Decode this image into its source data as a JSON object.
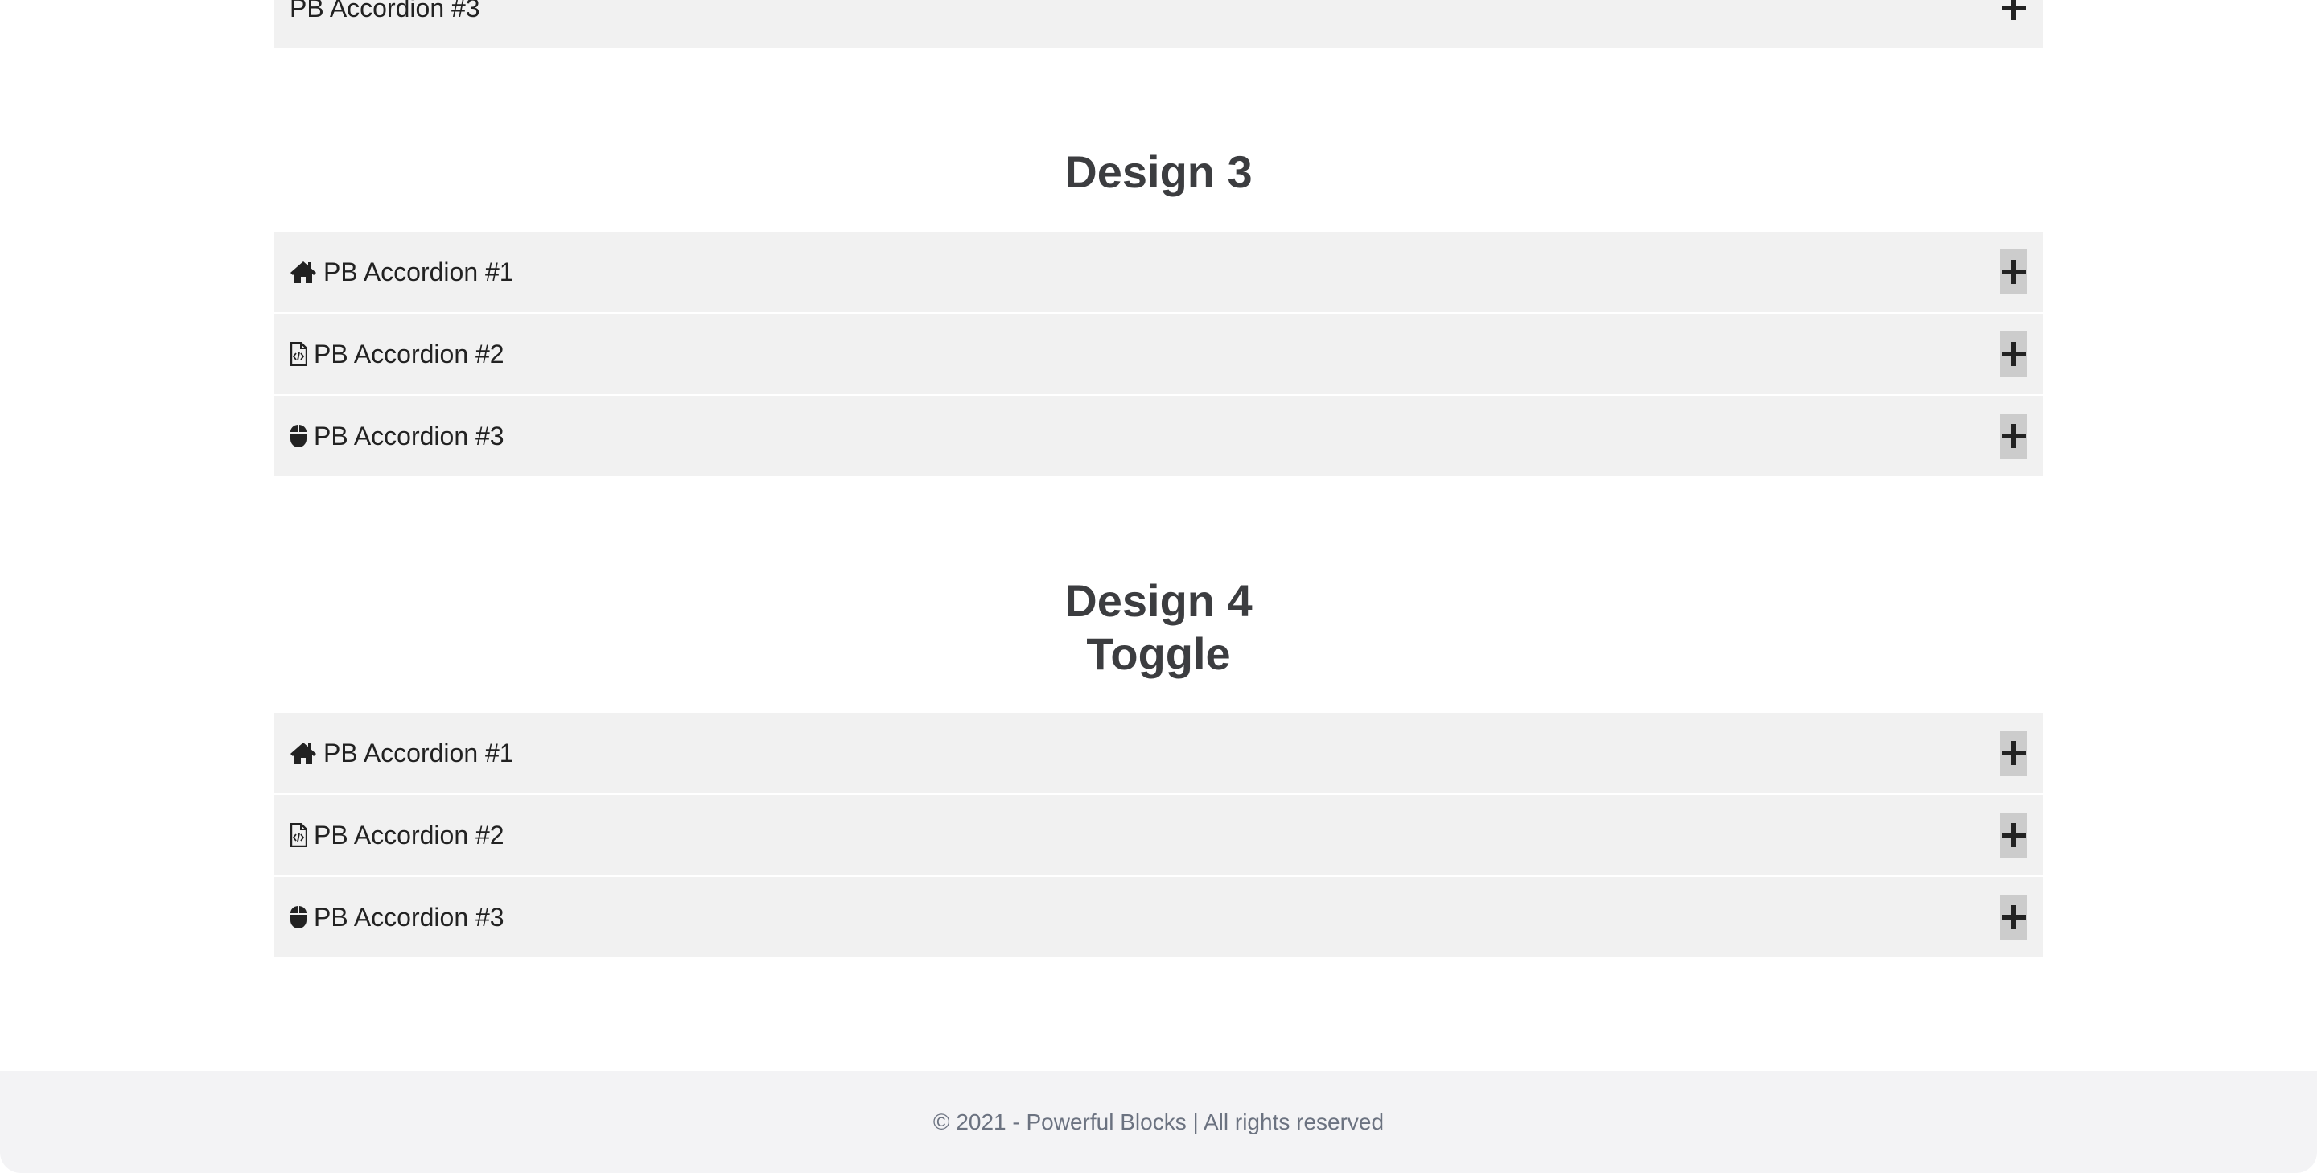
{
  "top_partial": {
    "label": "PB Accordion #3"
  },
  "design3": {
    "title": "Design 3",
    "items": [
      {
        "label": "PB Accordion #1",
        "icon": "home-icon"
      },
      {
        "label": "PB Accordion #2",
        "icon": "file-code-icon"
      },
      {
        "label": "PB Accordion #3",
        "icon": "mouse-icon"
      }
    ]
  },
  "design4": {
    "title_line1": "Design 4",
    "title_line2": "Toggle",
    "items": [
      {
        "label": "PB Accordion #1",
        "icon": "home-icon"
      },
      {
        "label": "PB Accordion #2",
        "icon": "file-code-icon"
      },
      {
        "label": "PB Accordion #3",
        "icon": "mouse-icon"
      }
    ]
  },
  "footer": {
    "text": "© 2021 - Powerful Blocks | All rights reserved"
  },
  "colors": {
    "accordion_bg": "#f1f1f1",
    "toggle_bg": "#cccccc",
    "heading": "#3c3d40",
    "footer_bg": "#f3f3f5",
    "footer_text": "#6b7280"
  }
}
